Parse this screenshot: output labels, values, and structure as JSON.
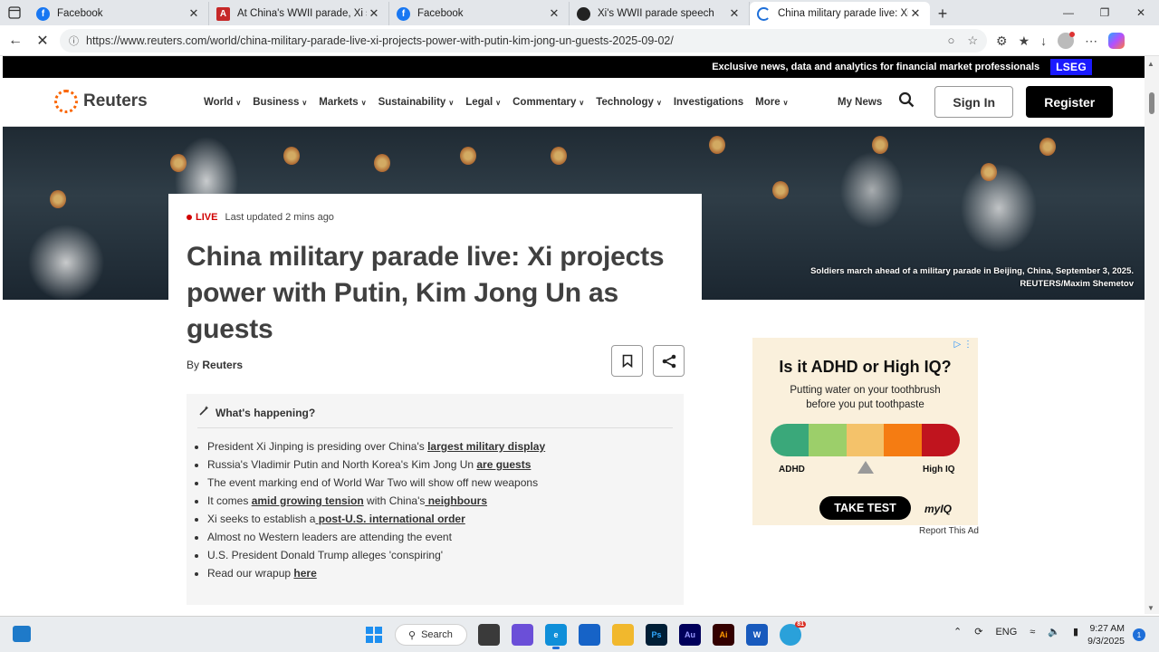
{
  "browser": {
    "tabs": [
      {
        "title": "Facebook",
        "icon": "facebook-icon",
        "color": "#1877f2"
      },
      {
        "title": "At China's WWII parade, Xi sa",
        "icon": "audio-icon",
        "color": "#c62828"
      },
      {
        "title": "Facebook",
        "icon": "facebook-icon",
        "color": "#1877f2"
      },
      {
        "title": "Xi's WWII parade speech",
        "icon": "openai-icon",
        "color": "#222222"
      },
      {
        "title": "China military parade live: Xi proj",
        "icon": "loading-icon",
        "color": "#1e6fd9",
        "active": true
      }
    ],
    "url": "https://www.reuters.com/world/china-military-parade-live-xi-projects-power-with-putin-kim-jong-un-guests-2025-09-02/"
  },
  "site": {
    "top_banner": "Exclusive news, data and analytics for financial market professionals",
    "lseg": "LSEG",
    "logo": "Reuters",
    "menu": [
      "World",
      "Business",
      "Markets",
      "Sustainability",
      "Legal",
      "Commentary",
      "Technology",
      "Investigations",
      "More"
    ],
    "menu_has_chevron": [
      true,
      true,
      true,
      true,
      true,
      true,
      true,
      false,
      true
    ],
    "my_news": "My News",
    "sign_in": "Sign In",
    "register": "Register"
  },
  "hero": {
    "caption_line1": "Soldiers march ahead of a military parade in Beijing, China, September 3, 2025.",
    "caption_line2": "REUTERS/Maxim Shemetov"
  },
  "article": {
    "live_label": "LIVE",
    "updated": "Last updated 2 mins ago",
    "headline": "China military parade live: Xi projects power with Putin, Kim Jong Un as guests",
    "by": "By",
    "author": "Reuters"
  },
  "happening": {
    "title": "What's happening?",
    "items": [
      {
        "text": "President Xi Jinping is presiding over China's ",
        "link": "largest military display",
        "after": ""
      },
      {
        "text": "Russia's Vladimir Putin and North Korea's Kim Jong Un ",
        "link": "are guests",
        "after": ""
      },
      {
        "text": "The event marking end of World War Two will show off new weapons",
        "link": "",
        "after": ""
      },
      {
        "text": "It comes ",
        "link": "amid growing tension",
        "after": " with China's",
        "link2": " neighbours"
      },
      {
        "text": "Xi seeks to establish a",
        "link": " post-U.S. international order",
        "after": ""
      },
      {
        "text": "Almost no Western leaders are attending the event",
        "link": "",
        "after": ""
      },
      {
        "text": "U.S. President Donald Trump alleges 'conspiring'",
        "link": "",
        "after": ""
      },
      {
        "text": "Read our wrapup ",
        "link": "here",
        "after": ""
      }
    ]
  },
  "ad": {
    "headline": "Is it ADHD or High IQ?",
    "sub_line1": "Putting water on your toothbrush",
    "sub_line2": "before you put toothpaste",
    "label_left": "ADHD",
    "label_right": "High IQ",
    "cta": "TAKE TEST",
    "brand": "myIQ",
    "colors": [
      "#3aa87a",
      "#9ccf6a",
      "#f4c26a",
      "#f57c12",
      "#c0141e"
    ],
    "report": "Report This Ad"
  },
  "taskbar": {
    "search": "Search",
    "lang": "ENG",
    "time": "9:27 AM",
    "date": "9/3/2025",
    "notifications": "1",
    "telegram_badge": "81"
  }
}
